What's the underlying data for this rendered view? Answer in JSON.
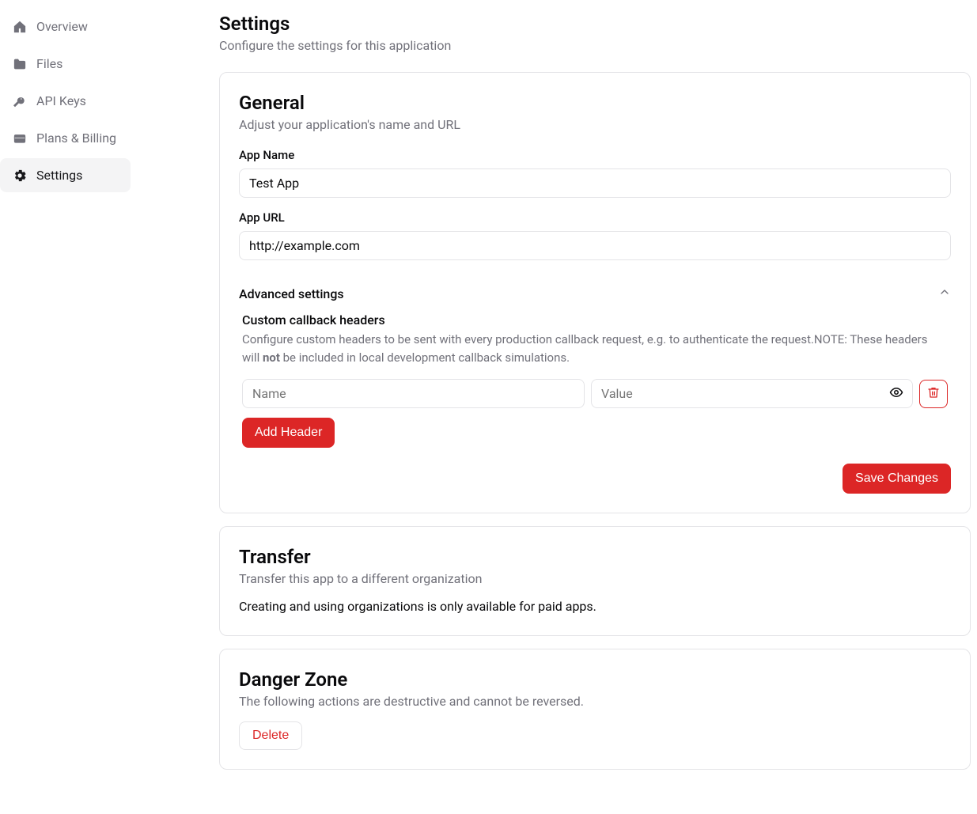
{
  "sidebar": {
    "items": [
      {
        "label": "Overview",
        "icon": "home"
      },
      {
        "label": "Files",
        "icon": "folder"
      },
      {
        "label": "API Keys",
        "icon": "key"
      },
      {
        "label": "Plans & Billing",
        "icon": "billing"
      },
      {
        "label": "Settings",
        "icon": "gear",
        "active": true
      }
    ]
  },
  "page": {
    "title": "Settings",
    "description": "Configure the settings for this application"
  },
  "general": {
    "title": "General",
    "description": "Adjust your application's name and URL",
    "app_name_label": "App Name",
    "app_name_value": "Test App",
    "app_url_label": "App URL",
    "app_url_value": "http://example.com",
    "advanced_label": "Advanced settings",
    "callbacks": {
      "title": "Custom callback headers",
      "desc_pre": "Configure custom headers to be sent with every production callback request, e.g. to authenticate the request.NOTE: These headers will ",
      "desc_bold": "not",
      "desc_post": " be included in local development callback simulations.",
      "name_placeholder": "Name",
      "value_placeholder": "Value",
      "add_label": "Add Header"
    },
    "save_label": "Save Changes"
  },
  "transfer": {
    "title": "Transfer",
    "description": "Transfer this app to a different organization",
    "body": "Creating and using organizations is only available for paid apps."
  },
  "danger": {
    "title": "Danger Zone",
    "description": "The following actions are destructive and cannot be reversed.",
    "delete_label": "Delete"
  }
}
